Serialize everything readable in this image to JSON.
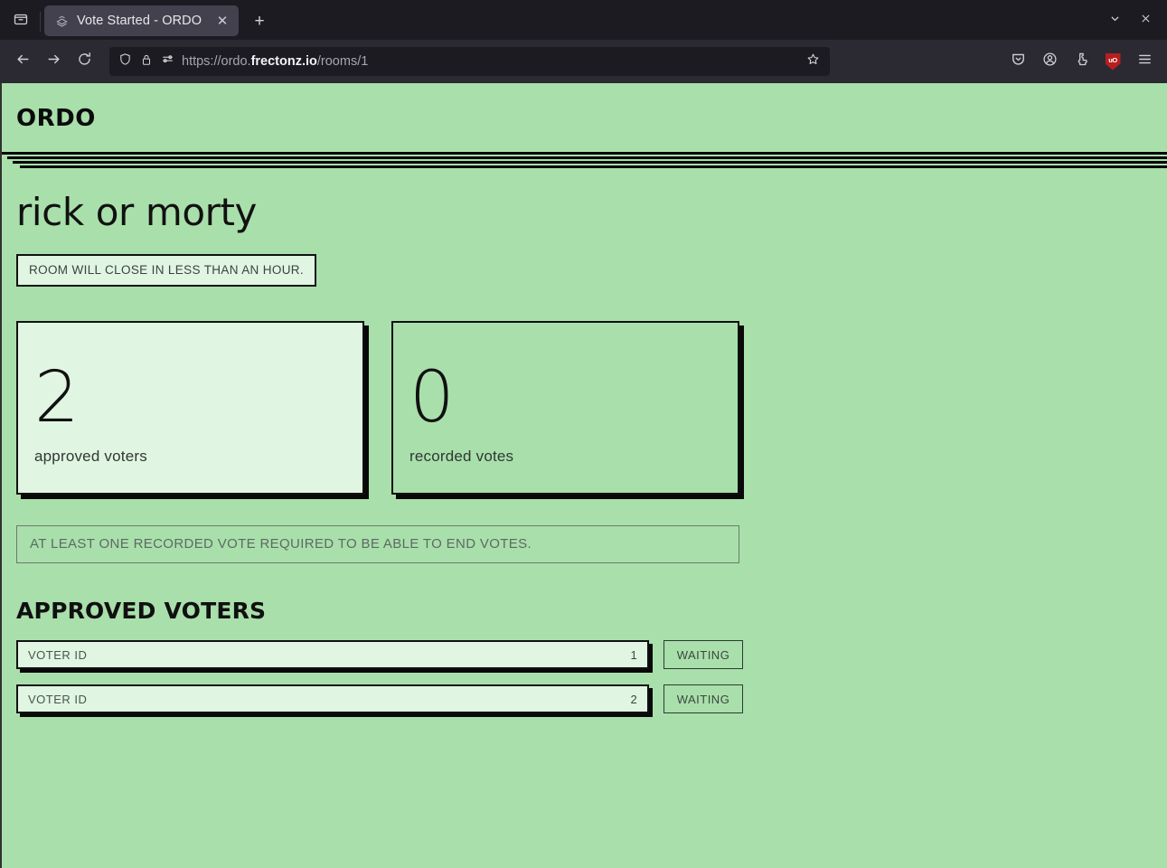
{
  "browser": {
    "tab": {
      "title": "Vote Started - ORDO",
      "favicon_icon": "stack-favicon",
      "close_icon": "close-icon"
    },
    "new_tab_icon": "plus-icon",
    "firefox_view_icon": "firefox-view-icon",
    "list_all_tabs_icon": "chevron-down-icon",
    "window_close_icon": "window-close-icon",
    "nav": {
      "back_icon": "back-arrow-icon",
      "forward_icon": "forward-arrow-icon",
      "reload_icon": "reload-icon"
    },
    "urlbar": {
      "shield_icon": "shield-icon",
      "lock_icon": "lock-icon",
      "permissions_icon": "permissions-sliders-icon",
      "url_prefix": "https://ordo.",
      "url_host": "frectonz.io",
      "url_path": "/rooms/1",
      "url_full": "https://ordo.frectonz.io/rooms/1",
      "bookmark_icon": "star-icon"
    },
    "toolbar_right": {
      "pocket_icon": "pocket-save-icon",
      "account_icon": "account-circle-icon",
      "extensions_icon": "extensions-puzzle-icon",
      "ublock_icon": "ublock-origin-shield-icon",
      "ublock_label": "uO",
      "menu_icon": "hamburger-menu-icon"
    }
  },
  "app": {
    "logo": "ORDO",
    "room_title": "rick or morty",
    "notice": "ROOM WILL CLOSE IN LESS THAN AN HOUR.",
    "stats": [
      {
        "value": "2",
        "label": "approved voters",
        "style": "tint"
      },
      {
        "value": "0",
        "label": "recorded votes",
        "style": "plain"
      }
    ],
    "info_bar": "AT LEAST ONE RECORDED VOTE REQUIRED TO BE ABLE TO END VOTES.",
    "section_title": "APPROVED VOTERS",
    "voters": [
      {
        "field_label": "VOTER ID",
        "value": "1",
        "status": "WAITING"
      },
      {
        "field_label": "VOTER ID",
        "value": "2",
        "status": "WAITING"
      }
    ]
  },
  "colors": {
    "page_bg": "#a9dfab",
    "card_tint": "#e0f5e2",
    "ink": "#111111",
    "muted": "#5c6b62",
    "chrome_tabstrip": "#1c1b22",
    "chrome_navbar": "#2b2a33",
    "ublock_red": "#b71f1f"
  }
}
